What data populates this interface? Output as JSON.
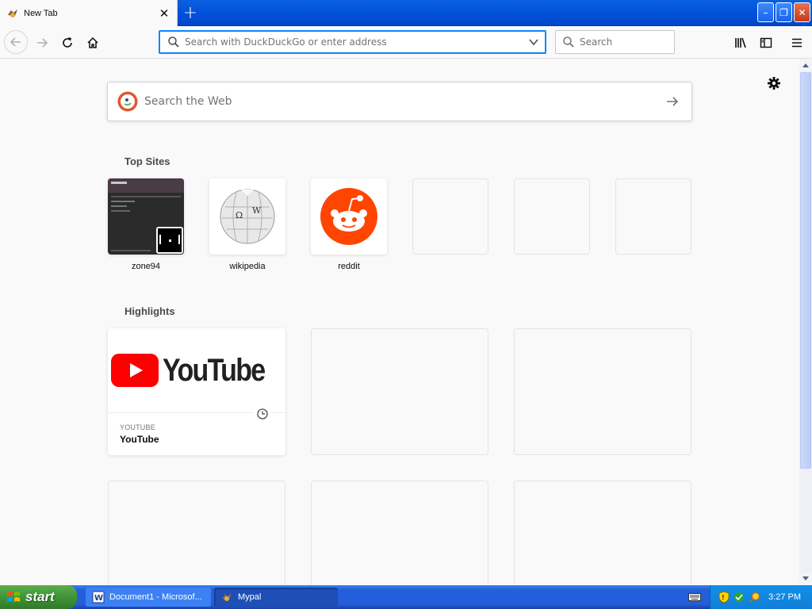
{
  "tab": {
    "title": "New Tab",
    "close_symbol": "✕",
    "new_tab_symbol": "+"
  },
  "window": {
    "minimize": "–",
    "restore": "❐",
    "close": "✕"
  },
  "toolbar": {
    "url_placeholder": "Search with DuckDuckGo or enter address",
    "search_placeholder": "Search"
  },
  "page": {
    "search_placeholder": "Search the Web",
    "top_sites_title": "Top Sites",
    "highlights_title": "Highlights",
    "top_sites": [
      {
        "label": "zone94"
      },
      {
        "label": "wikipedia"
      },
      {
        "label": "reddit"
      }
    ],
    "highlight": {
      "host": "YOUTUBE",
      "title": "YouTube",
      "logo_text": "YouTube"
    }
  },
  "taskbar": {
    "start_label": "start",
    "items": [
      {
        "label": "Document1 - Microsof..."
      },
      {
        "label": "Mypal"
      }
    ],
    "time": "3:27 PM"
  },
  "colors": {
    "accent": "#0a84ff",
    "reddit": "#ff4500",
    "youtube_red": "#ff0000"
  }
}
